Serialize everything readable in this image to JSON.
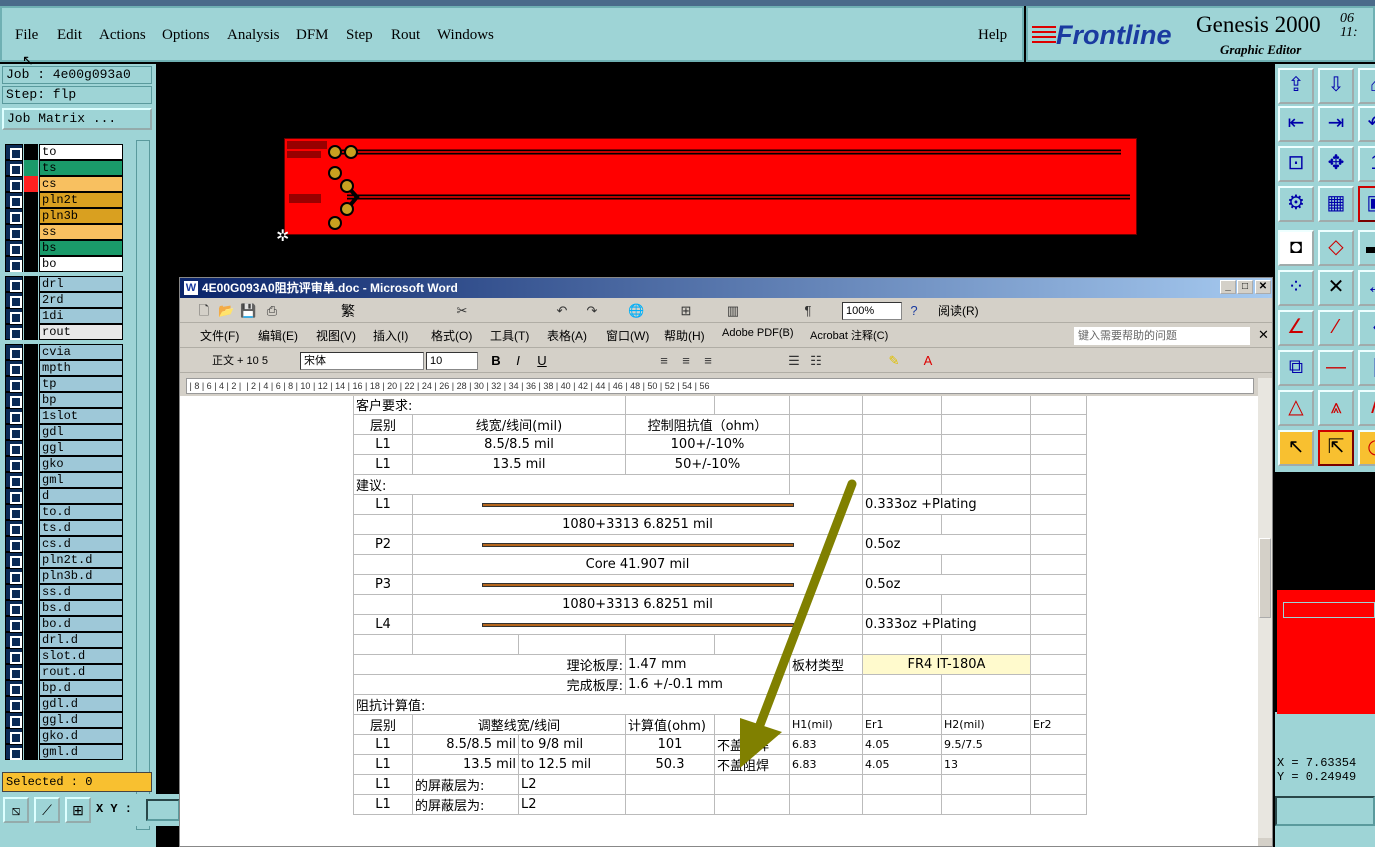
{
  "menu": [
    "File",
    "Edit",
    "Actions",
    "Options",
    "Analysis",
    "DFM",
    "Step",
    "Rout",
    "Windows"
  ],
  "help": "Help",
  "brand": {
    "logo": "Frontline",
    "product": "Genesis 2000",
    "subtitle": "Graphic Editor",
    "date1": "06",
    "date2": "11:"
  },
  "job": "Job : 4e00g093a0",
  "step": "Step: flp",
  "job_matrix": "Job Matrix ...",
  "layers": [
    {
      "name": "to",
      "color": "#ffffff",
      "swatch": "#000000"
    },
    {
      "name": "ts",
      "color": "#1a9a6a",
      "swatch": "#1a9a6a"
    },
    {
      "name": "cs",
      "color": "#f8c060",
      "swatch": "#ff2020"
    },
    {
      "name": "pln2t",
      "color": "#d9a020",
      "swatch": "#000000"
    },
    {
      "name": "pln3b",
      "color": "#d9a020",
      "swatch": "#000000"
    },
    {
      "name": "ss",
      "color": "#f8c060",
      "swatch": "#000000"
    },
    {
      "name": "bs",
      "color": "#1a9a6a",
      "swatch": "#000000"
    },
    {
      "name": "bo",
      "color": "#ffffff",
      "swatch": "#000000"
    },
    {
      "name": "drl",
      "color": "#9ec8d8",
      "swatch": "#000000"
    },
    {
      "name": "2rd",
      "color": "#9ec8d8",
      "swatch": "#000000"
    },
    {
      "name": "1di",
      "color": "#9ec8d8",
      "swatch": "#000000"
    },
    {
      "name": "rout",
      "color": "#e8e8e8",
      "swatch": "#000000"
    },
    {
      "name": "cvia",
      "color": "#9ec8d8",
      "swatch": "#000000"
    },
    {
      "name": "mpth",
      "color": "#9ec8d8",
      "swatch": "#000000"
    },
    {
      "name": "tp",
      "color": "#9ec8d8",
      "swatch": "#000000"
    },
    {
      "name": "bp",
      "color": "#9ec8d8",
      "swatch": "#000000"
    },
    {
      "name": "1slot",
      "color": "#9ec8d8",
      "swatch": "#000000"
    },
    {
      "name": "gdl",
      "color": "#9ec8d8",
      "swatch": "#000000"
    },
    {
      "name": "ggl",
      "color": "#9ec8d8",
      "swatch": "#000000"
    },
    {
      "name": "gko",
      "color": "#9ec8d8",
      "swatch": "#000000"
    },
    {
      "name": "gml",
      "color": "#9ec8d8",
      "swatch": "#000000"
    },
    {
      "name": "d",
      "color": "#9ec8d8",
      "swatch": "#000000"
    },
    {
      "name": "to.d",
      "color": "#9ec8d8",
      "swatch": "#000000"
    },
    {
      "name": "ts.d",
      "color": "#9ec8d8",
      "swatch": "#000000"
    },
    {
      "name": "cs.d",
      "color": "#9ec8d8",
      "swatch": "#000000"
    },
    {
      "name": "pln2t.d",
      "color": "#9ec8d8",
      "swatch": "#000000"
    },
    {
      "name": "pln3b.d",
      "color": "#9ec8d8",
      "swatch": "#000000"
    },
    {
      "name": "ss.d",
      "color": "#9ec8d8",
      "swatch": "#000000"
    },
    {
      "name": "bs.d",
      "color": "#9ec8d8",
      "swatch": "#000000"
    },
    {
      "name": "bo.d",
      "color": "#9ec8d8",
      "swatch": "#000000"
    },
    {
      "name": "drl.d",
      "color": "#9ec8d8",
      "swatch": "#000000"
    },
    {
      "name": "slot.d",
      "color": "#9ec8d8",
      "swatch": "#000000"
    },
    {
      "name": "rout.d",
      "color": "#9ec8d8",
      "swatch": "#000000"
    },
    {
      "name": "bp.d",
      "color": "#9ec8d8",
      "swatch": "#000000"
    },
    {
      "name": "gdl.d",
      "color": "#9ec8d8",
      "swatch": "#000000"
    },
    {
      "name": "ggl.d",
      "color": "#9ec8d8",
      "swatch": "#000000"
    },
    {
      "name": "gko.d",
      "color": "#9ec8d8",
      "swatch": "#000000"
    },
    {
      "name": "gml.d",
      "color": "#9ec8d8",
      "swatch": "#000000"
    }
  ],
  "selected": "Selected : 0",
  "xy_label": "X Y :",
  "coords": {
    "x": "X = 7.63354",
    "y": "Y = 0.24949"
  },
  "word": {
    "title": "4E00G093A0阻抗评审单.doc - Microsoft Word",
    "menu": [
      "文件(F)",
      "编辑(E)",
      "视图(V)",
      "插入(I)",
      "格式(O)",
      "工具(T)",
      "表格(A)",
      "窗口(W)",
      "帮助(H)",
      "Adobe PDF(B)",
      "Acrobat 注释(C)"
    ],
    "help_placeholder": "键入需要帮助的问题",
    "zoom": "100%",
    "read_btn": "阅读(R)",
    "style": "正文 + 10 5",
    "font": "宋体",
    "size": "10",
    "traditional": "繁"
  },
  "doc": {
    "customer_req": "客户要求:",
    "h_layer": "层别",
    "h_width": "线宽/线间(mil)",
    "h_ctrl": "控制阻抗值（ohm）",
    "req1": {
      "layer": "L1",
      "width": "8.5/8.5 mil",
      "ctrl": "100+/-10%"
    },
    "req2": {
      "layer": "L1",
      "width": "13.5 mil",
      "ctrl": "50+/-10%"
    },
    "suggest": "建议:",
    "stack": [
      {
        "layer": "L1",
        "note": "0.333oz +Plating"
      },
      {
        "mid": "1080+3313    6.8251 mil"
      },
      {
        "layer": "P2",
        "note": "0.5oz"
      },
      {
        "mid": "Core   41.907 mil"
      },
      {
        "layer": "P3",
        "note": "0.5oz"
      },
      {
        "mid": "1080+3313    6.8251 mil"
      },
      {
        "layer": "L4",
        "note": "0.333oz +Plating"
      }
    ],
    "theory_label": "理论板厚:",
    "theory_val": "1.47 mm",
    "mat_label": "板材类型",
    "mat_val": "FR4 IT-180A",
    "final_label": "完成板厚:",
    "final_val": "1.6 +/-0.1 mm",
    "calc_title": "阻抗计算值:",
    "c_layer": "层别",
    "c_adj": "调整线宽/线间",
    "c_calc": "计算值(ohm)",
    "c_h1": "H1(mil)",
    "c_er1": "Er1",
    "c_h2": "H2(mil)",
    "c_er2": "Er2",
    "calc1": {
      "layer": "L1",
      "w1": "8.5/8.5 mil",
      "w2": "to 9/8 mil",
      "val": "101",
      "mask": "不盖阻焊",
      "h1": "6.83",
      "er1": "4.05",
      "h2": "9.5/7.5"
    },
    "calc2": {
      "layer": "L1",
      "w1": "13.5 mil",
      "w2": "to 12.5 mil",
      "val": "50.3",
      "mask": "不盖阻焊",
      "h1": "6.83",
      "er1": "4.05",
      "h2": "13"
    },
    "shield1": {
      "layer": "L1",
      "label": "的屏蔽层为:",
      "ref": "L2"
    },
    "shield2": {
      "layer": "L1",
      "label": "的屏蔽层为:",
      "ref": "L2"
    }
  },
  "colors": {
    "panel": "#9ed4d6",
    "pcb": "#ff0000",
    "arrow": "#808000"
  }
}
